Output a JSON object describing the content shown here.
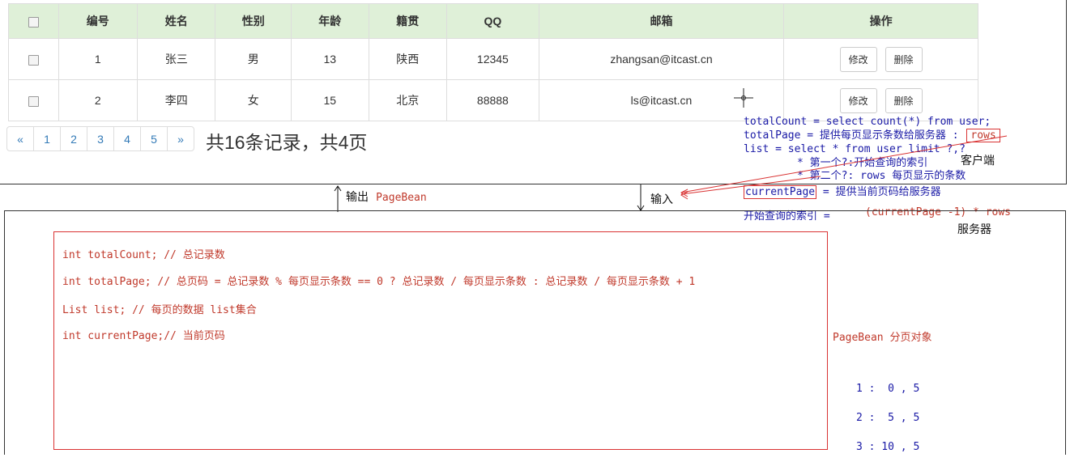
{
  "table": {
    "headers": [
      "编号",
      "姓名",
      "性别",
      "年龄",
      "籍贯",
      "QQ",
      "邮箱",
      "操作"
    ],
    "rows": [
      {
        "id": "1",
        "name": "张三",
        "gender": "男",
        "age": "13",
        "hometown": "陕西",
        "qq": "12345",
        "email": "zhangsan@itcast.cn"
      },
      {
        "id": "2",
        "name": "李四",
        "gender": "女",
        "age": "15",
        "hometown": "北京",
        "qq": "88888",
        "email": "ls@itcast.cn"
      }
    ],
    "edit_label": "修改",
    "delete_label": "删除"
  },
  "pagination": {
    "prev": "«",
    "pages": [
      "1",
      "2",
      "3",
      "4",
      "5"
    ],
    "next": "»",
    "summary": "共16条记录，共4页"
  },
  "annotations": {
    "sql_count": "totalCount = select count(*) from user;",
    "total_page_prefix": "totalPage = 提供每页显示条数给服务器 :",
    "rows_word": "rows",
    "list_sql": "list = select * from user limit ?,?",
    "client_label": "客户端",
    "first_q": "* 第一个?:开始查询的索引",
    "second_q": "* 第二个?: rows 每页显示的条数",
    "current_page_word": "currentPage",
    "current_page_suffix": "= 提供当前页码给服务器",
    "start_index_prefix": "开始查询的索引 =",
    "start_index_formula": "(currentPage -1) * rows",
    "server_label": "服务器",
    "output_label": "输出",
    "output_bean": "PageBean",
    "input_label": "输入"
  },
  "code": {
    "line1": "int totalCount; // 总记录数",
    "line2": "int totalPage; // 总页码 = 总记录数 % 每页显示条数 == 0 ? 总记录数 / 每页显示条数 : 总记录数 / 每页显示条数 + 1",
    "line3": "List list;  // 每页的数据 list集合",
    "line4": "int currentPage;// 当前页码"
  },
  "pagebean_label": "PageBean 分页对象",
  "offsets": [
    "1 :  0 , 5",
    "2 :  5 , 5",
    "3 : 10 , 5"
  ],
  "colors": {
    "table_header_bg": "#dff0d8",
    "link_blue": "#337ab7",
    "annotation_blue": "#1a1aa6",
    "annotation_red": "#c0392b"
  }
}
